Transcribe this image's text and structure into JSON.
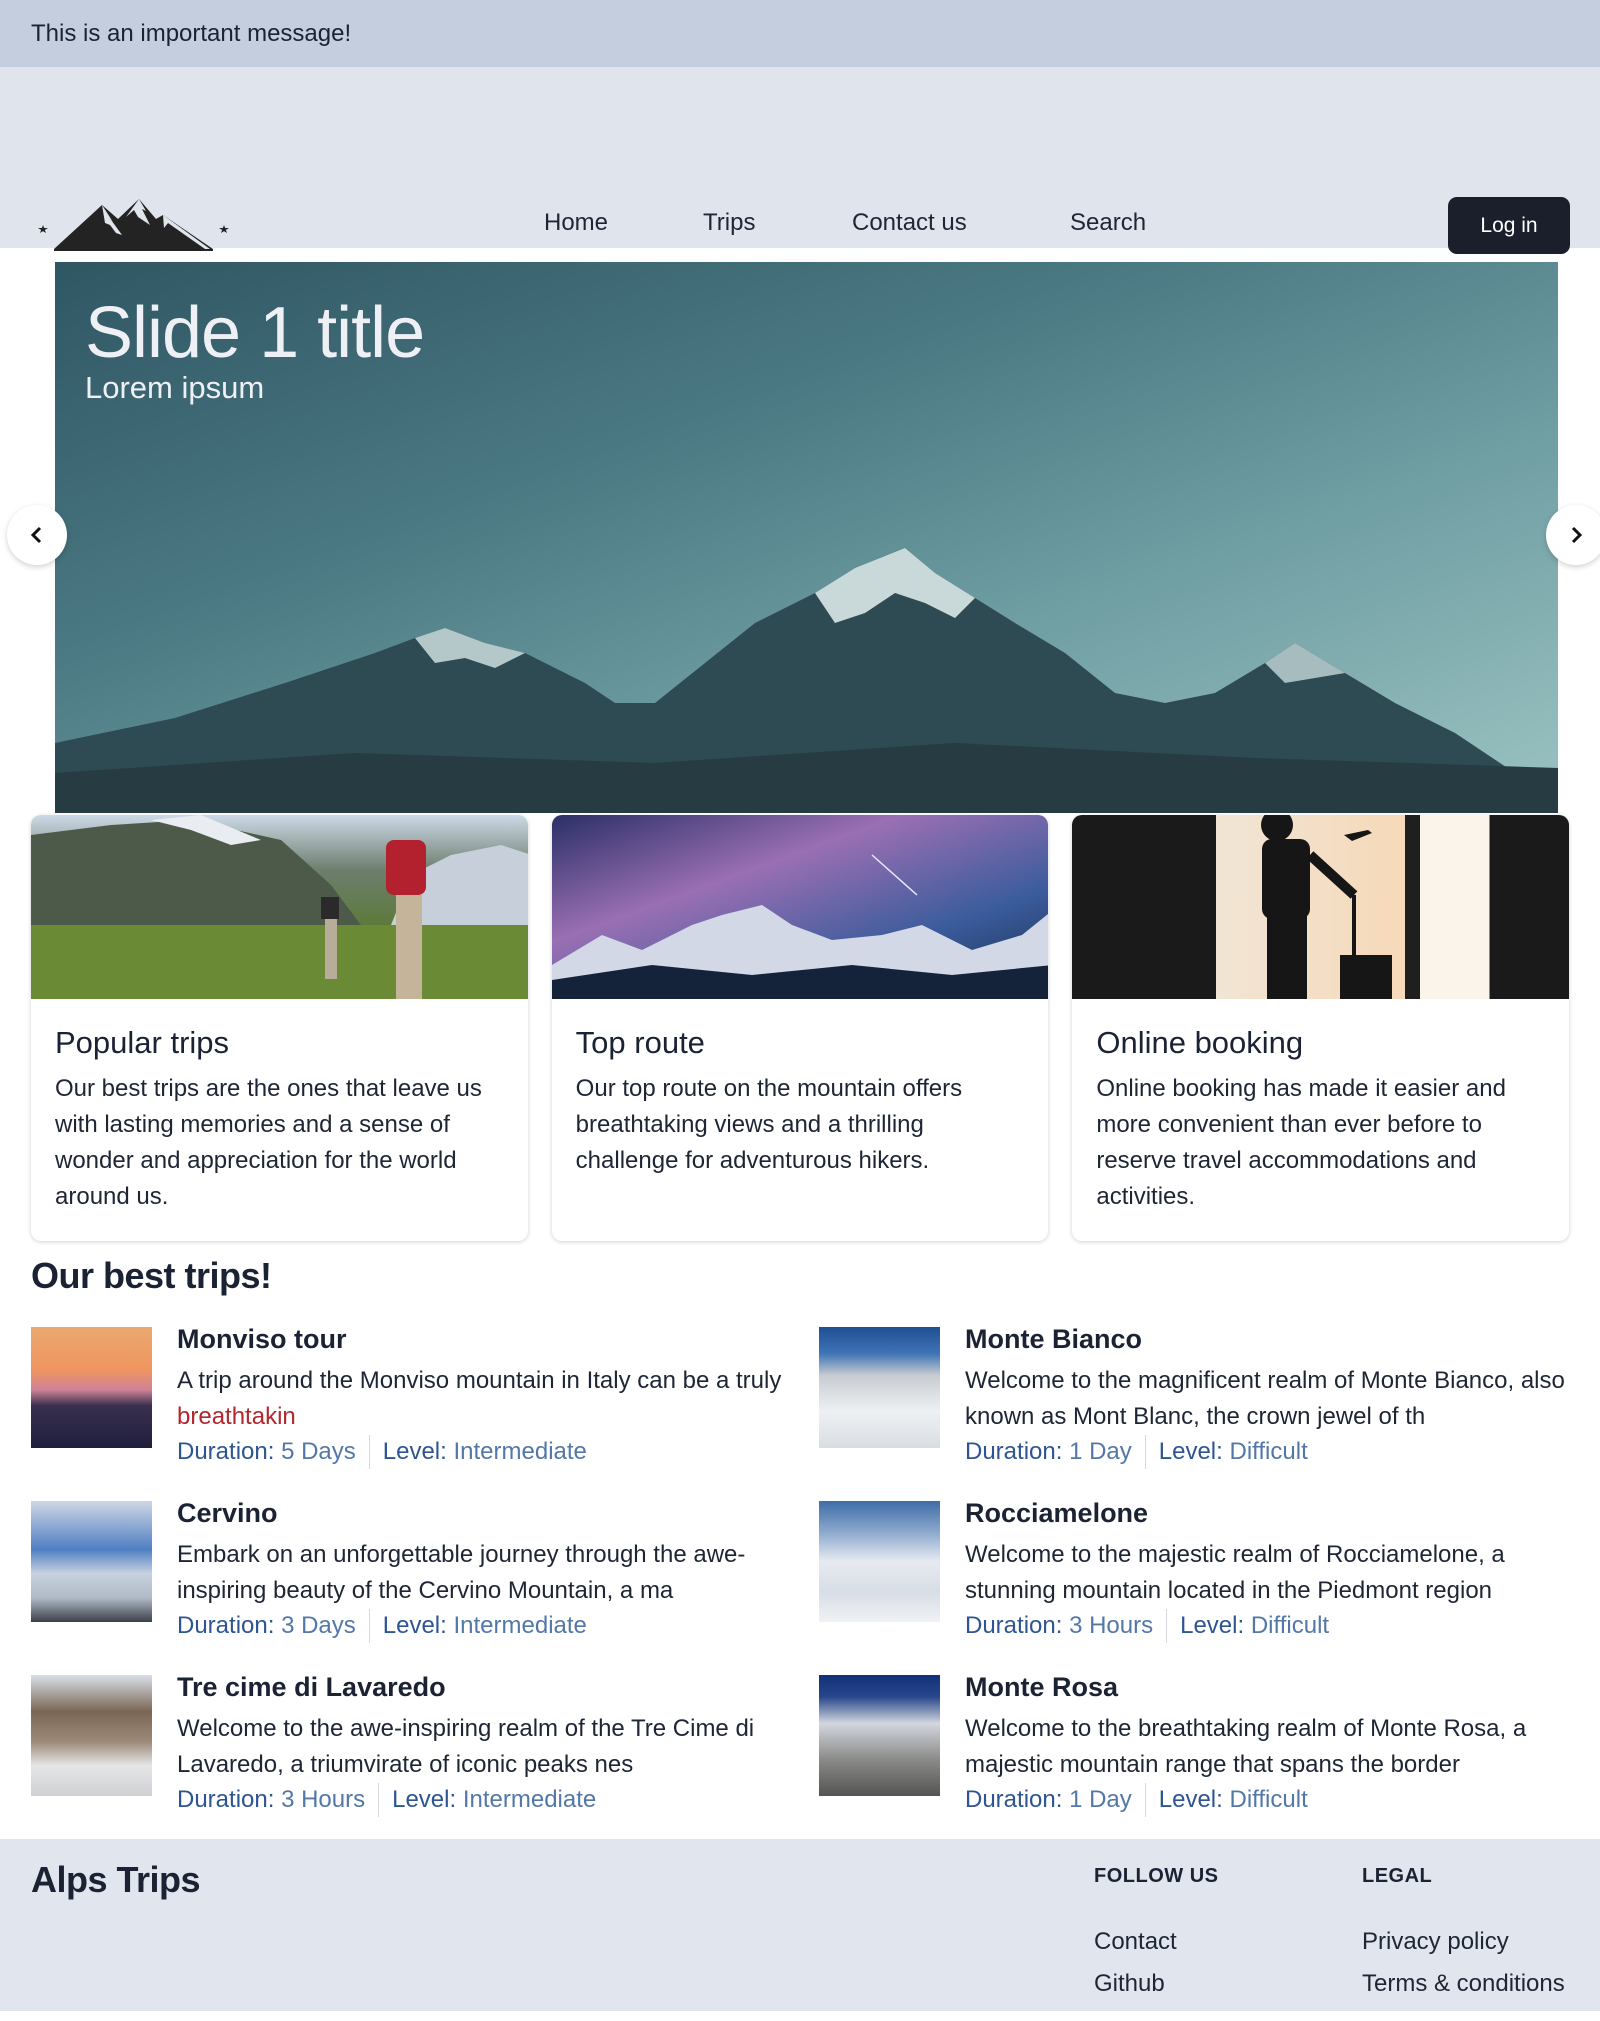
{
  "announcement": "This is an important message!",
  "header": {
    "logo": "mountain-logo",
    "nav": [
      "Home",
      "Trips",
      "Contact us",
      "Search"
    ],
    "login_label": "Log in"
  },
  "carousel": {
    "slide_title": "Slide 1 title",
    "slide_subtitle": "Lorem ipsum",
    "prev_icon": "chevron-left-icon",
    "next_icon": "chevron-right-icon"
  },
  "feature_cards": [
    {
      "title": "Popular trips",
      "text": "Our best trips are the ones that leave us with lasting memories and a sense of wonder and appreciation for the world around us.",
      "image": "hikers-in-mountains"
    },
    {
      "title": "Top route",
      "text": "Our top route on the mountain offers breathtaking views and a thrilling challenge for adventurous hikers.",
      "image": "starry-night-mountains"
    },
    {
      "title": "Online booking",
      "text": "Online booking has made it easier and more convenient than ever before to reserve travel accommodations and activities.",
      "image": "traveler-silhouette-with-suitcase"
    }
  ],
  "best_trips": {
    "title": "Our best trips!",
    "duration_label": "Duration:",
    "level_label": "Level:",
    "items": [
      {
        "name": "Monviso tour",
        "desc": "A trip around the Monviso mountain in Italy can be a truly ",
        "desc_highlight": "breathtakin",
        "duration": "5 Days",
        "level": "Intermediate"
      },
      {
        "name": "Monte Bianco",
        "desc": "Welcome to the magnificent realm of Monte Bianco, also known as Mont Blanc, the crown jewel of th",
        "desc_highlight": "",
        "duration": "1 Day",
        "level": "Difficult"
      },
      {
        "name": "Cervino",
        "desc": "Embark on an unforgettable journey through the awe-inspiring beauty of the Cervino Mountain, a ma",
        "desc_highlight": "",
        "duration": "3 Days",
        "level": "Intermediate"
      },
      {
        "name": "Rocciamelone",
        "desc": "Welcome to the majestic realm of Rocciamelone, a stunning mountain located in the Piedmont region",
        "desc_highlight": "",
        "duration": "3 Hours",
        "level": "Difficult"
      },
      {
        "name": "Tre cime di Lavaredo",
        "desc": "Welcome to the awe-inspiring realm of the Tre Cime di Lavaredo, a triumvirate of iconic peaks nes",
        "desc_highlight": "",
        "duration": "3 Hours",
        "level": "Intermediate"
      },
      {
        "name": "Monte Rosa",
        "desc": "Welcome to the breathtaking realm of Monte Rosa, a majestic mountain range that spans the border",
        "desc_highlight": "",
        "duration": "1 Day",
        "level": "Difficult"
      }
    ]
  },
  "footer": {
    "brand": "Alps Trips",
    "follow_heading": "FOLLOW US",
    "follow_links": [
      "Contact",
      "Github"
    ],
    "legal_heading": "LEGAL",
    "legal_links": [
      "Privacy policy",
      "Terms & conditions"
    ]
  },
  "colors": {
    "announcement_bg": "#c5cedf",
    "header_bg": "#e0e5ed",
    "button_dark": "#1a1f2b",
    "meta_label": "#2e5592",
    "meta_value": "#5378a8",
    "highlight_red": "#b3262d"
  }
}
